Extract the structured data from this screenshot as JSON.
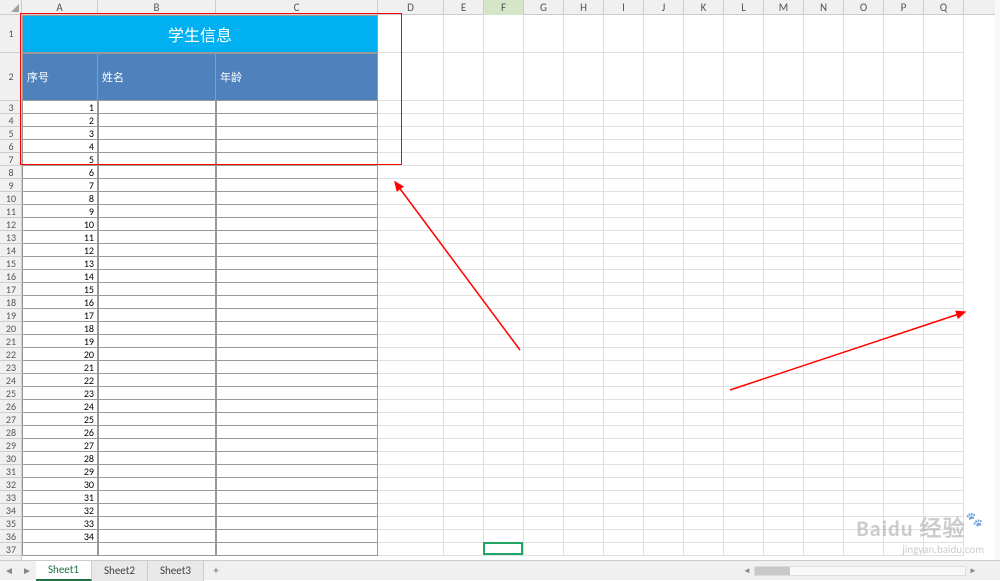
{
  "columns": [
    "A",
    "B",
    "C",
    "D",
    "E",
    "F",
    "G",
    "H",
    "I",
    "J",
    "K",
    "L",
    "M",
    "N",
    "O",
    "P",
    "Q"
  ],
  "col_widths": {
    "A": 76,
    "B": 118,
    "C": 162,
    "D": 66,
    "E": 40,
    "F": 40,
    "G": 40,
    "H": 40,
    "I": 40,
    "J": 40,
    "K": 40,
    "L": 40,
    "M": 40,
    "N": 40,
    "O": 40,
    "P": 40,
    "Q": 40
  },
  "row_heights": {
    "1": 38,
    "2": 48
  },
  "default_row_height": 13,
  "visible_rows": 37,
  "title": "学生信息",
  "headers": {
    "A": "序号",
    "B": "姓名",
    "C": "年龄"
  },
  "data_values": [
    1,
    2,
    3,
    4,
    5,
    6,
    7,
    8,
    9,
    10,
    11,
    12,
    13,
    14,
    15,
    16,
    17,
    18,
    19,
    20,
    21,
    22,
    23,
    24,
    25,
    26,
    27,
    28,
    29,
    30,
    31,
    32,
    33,
    34
  ],
  "active_cell_column": "F",
  "sheets": [
    "Sheet1",
    "Sheet2",
    "Sheet3"
  ],
  "active_sheet": "Sheet1",
  "watermark": {
    "brand": "Baidu 经验",
    "url": "jingyan.baidu.com"
  },
  "colors": {
    "title_bg": "#00b0f0",
    "header_bg": "#4f81bd",
    "highlight": "#ff0000",
    "active_border": "#22a463"
  }
}
